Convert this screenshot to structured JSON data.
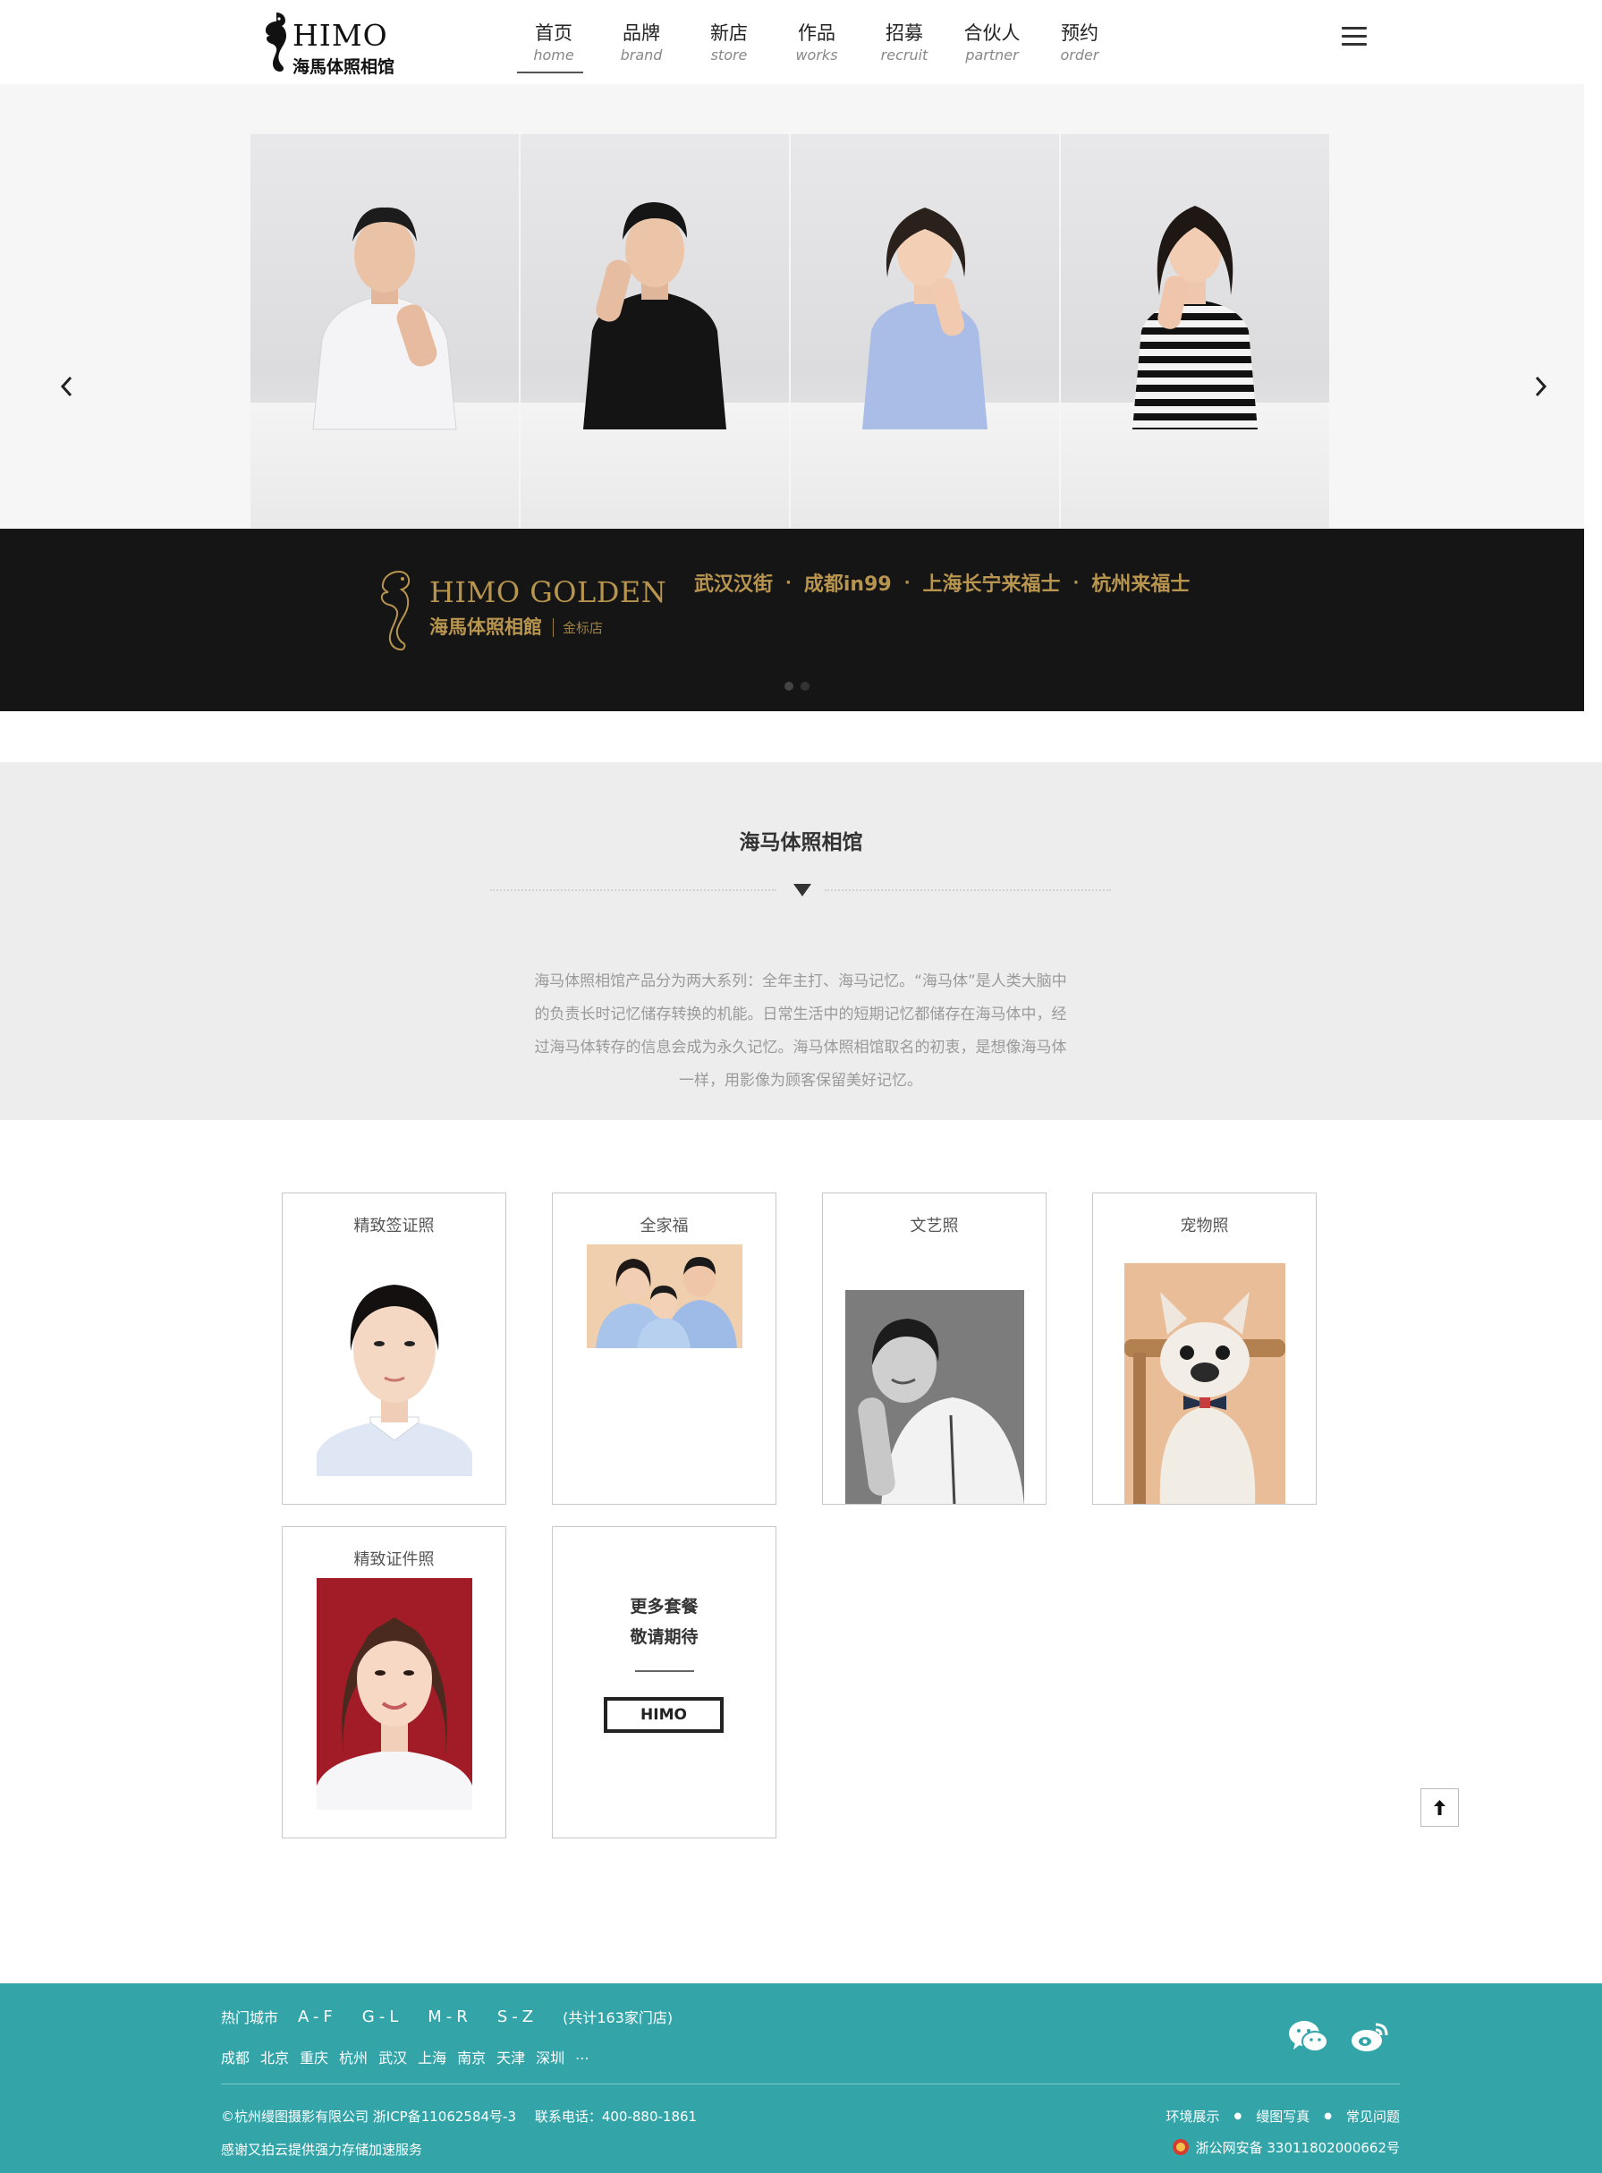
{
  "brand": {
    "name_en": "HIMO",
    "name_cn": "海馬体照相馆"
  },
  "nav": [
    {
      "cn": "首页",
      "en": "home"
    },
    {
      "cn": "品牌",
      "en": "brand"
    },
    {
      "cn": "新店",
      "en": "store"
    },
    {
      "cn": "作品",
      "en": "works"
    },
    {
      "cn": "招募",
      "en": "recruit"
    },
    {
      "cn": "合伙人",
      "en": "partner"
    },
    {
      "cn": "预约",
      "en": "order"
    }
  ],
  "promo": {
    "logo_en": "HIMO GOLDEN",
    "logo_cn": "海馬体照相館",
    "logo_sub": "金标店",
    "stores": [
      "武汉汉街",
      "成都in99",
      "上海长宁来福士",
      "杭州来福士"
    ],
    "separator": "·"
  },
  "intro": {
    "title": "海马体照相馆",
    "text": "海马体照相馆产品分为两大系列：全年主打、海马记忆。“海马体”是人类大脑中的负责长时记忆储存转换的机能。日常生活中的短期记忆都储存在海马体中，经过海马体转存的信息会成为永久记忆。海马体照相馆取名的初衷，是想像海马体一样，用影像为顾客保留美好记忆。"
  },
  "products": [
    {
      "title": "精致签证照"
    },
    {
      "title": "全家福"
    },
    {
      "title": "文艺照"
    },
    {
      "title": "宠物照"
    },
    {
      "title": "精致证件照"
    }
  ],
  "more": {
    "line1": "更多套餐",
    "line2": "敬请期待",
    "button": "HIMO"
  },
  "footer": {
    "hot_label": "热门城市",
    "letters": [
      "A-F",
      "G-L",
      "M-R",
      "S-Z"
    ],
    "count": "(共计163家门店)",
    "cities": [
      "成都",
      "北京",
      "重庆",
      "杭州",
      "武汉",
      "上海",
      "南京",
      "天津",
      "深圳",
      "..."
    ],
    "copyright": "©杭州缦图摄影有限公司 浙ICP备11062584号-3",
    "phone": "联系电话：400-880-1861",
    "thanks": "感谢又拍云提供强力存储加速服务",
    "links": [
      "环境展示",
      "缦图写真",
      "常见问题"
    ],
    "police": "浙公网安备 33011802000662号"
  },
  "colors": {
    "footer_bg": "#33a5a9",
    "gold": "#b8954f",
    "promo_bg": "#151515"
  }
}
